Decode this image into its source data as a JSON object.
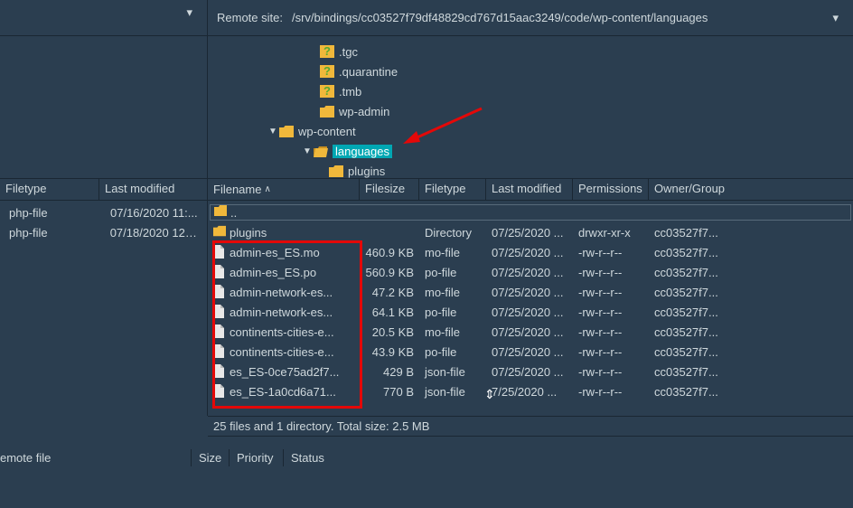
{
  "top": {
    "remote_label": "Remote site:",
    "remote_path": "/srv/bindings/cc03527f79df48829cd767d15aac3249/code/wp-content/languages"
  },
  "tree": [
    {
      "indent": 110,
      "chev": "",
      "icon": "q",
      "label": ".tgc"
    },
    {
      "indent": 110,
      "chev": "",
      "icon": "q",
      "label": ".quarantine"
    },
    {
      "indent": 110,
      "chev": "",
      "icon": "q",
      "label": ".tmb"
    },
    {
      "indent": 110,
      "chev": "",
      "icon": "folder",
      "label": "wp-admin"
    },
    {
      "indent": 65,
      "chev": "▼",
      "icon": "folder",
      "label": "wp-content"
    },
    {
      "indent": 103,
      "chev": "▼",
      "icon": "folder-open",
      "label": "languages",
      "selected": true
    },
    {
      "indent": 120,
      "chev": "",
      "icon": "folder",
      "label": "plugins"
    }
  ],
  "left_headers": {
    "filetype": "Filetype",
    "modified": "Last modified"
  },
  "right_headers": {
    "filename": "Filename",
    "filesize": "Filesize",
    "filetype": "Filetype",
    "modified": "Last modified",
    "perms": "Permissions",
    "owner": "Owner/Group"
  },
  "left_rows": [
    {
      "filetype": "php-file",
      "modified": "07/16/2020 11:..."
    },
    {
      "filetype": "php-file",
      "modified": "07/18/2020 12:..."
    }
  ],
  "right_rows": [
    {
      "name": "plugins",
      "icon": "folder",
      "size": "",
      "type": "Directory",
      "modified": "07/25/2020 ...",
      "perms": "drwxr-xr-x",
      "owner": "cc03527f7..."
    },
    {
      "name": "admin-es_ES.mo",
      "icon": "file",
      "size": "460.9 KB",
      "type": "mo-file",
      "modified": "07/25/2020 ...",
      "perms": "-rw-r--r--",
      "owner": "cc03527f7..."
    },
    {
      "name": "admin-es_ES.po",
      "icon": "file",
      "size": "560.9 KB",
      "type": "po-file",
      "modified": "07/25/2020 ...",
      "perms": "-rw-r--r--",
      "owner": "cc03527f7..."
    },
    {
      "name": "admin-network-es...",
      "icon": "file",
      "size": "47.2 KB",
      "type": "mo-file",
      "modified": "07/25/2020 ...",
      "perms": "-rw-r--r--",
      "owner": "cc03527f7..."
    },
    {
      "name": "admin-network-es...",
      "icon": "file",
      "size": "64.1 KB",
      "type": "po-file",
      "modified": "07/25/2020 ...",
      "perms": "-rw-r--r--",
      "owner": "cc03527f7..."
    },
    {
      "name": "continents-cities-e...",
      "icon": "file",
      "size": "20.5 KB",
      "type": "mo-file",
      "modified": "07/25/2020 ...",
      "perms": "-rw-r--r--",
      "owner": "cc03527f7..."
    },
    {
      "name": "continents-cities-e...",
      "icon": "file",
      "size": "43.9 KB",
      "type": "po-file",
      "modified": "07/25/2020 ...",
      "perms": "-rw-r--r--",
      "owner": "cc03527f7..."
    },
    {
      "name": "es_ES-0ce75ad2f7...",
      "icon": "file",
      "size": "429 B",
      "type": "json-file",
      "modified": "07/25/2020 ...",
      "perms": "-rw-r--r--",
      "owner": "cc03527f7..."
    },
    {
      "name": "es_ES-1a0cd6a71...",
      "icon": "file",
      "size": "770 B",
      "type": "json-file",
      "modified": "7/25/2020 ...",
      "perms": "-rw-r--r--",
      "owner": "cc03527f7..."
    }
  ],
  "status": "25 files and 1 directory. Total size: 2.5 MB",
  "queue": {
    "remote": "emote file",
    "size": "Size",
    "priority": "Priority",
    "status": "Status"
  },
  "up": ".."
}
